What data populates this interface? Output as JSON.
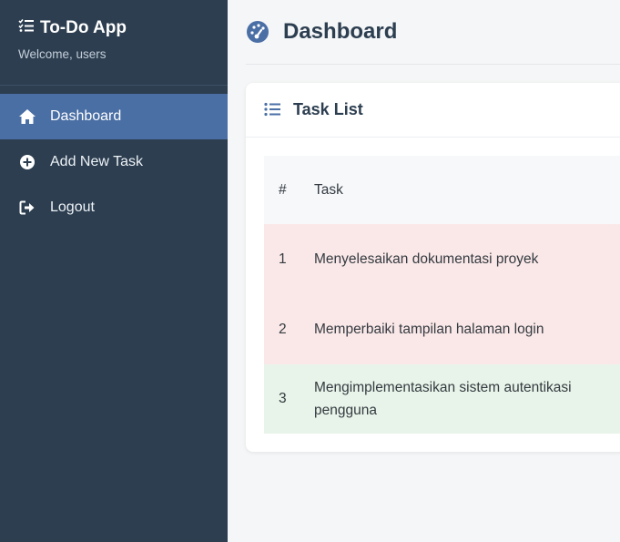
{
  "app": {
    "title": "To-Do App",
    "welcome": "Welcome, users"
  },
  "sidebar": {
    "items": [
      {
        "label": "Dashboard",
        "icon": "home-icon",
        "active": true
      },
      {
        "label": "Add New Task",
        "icon": "plus-circle-icon",
        "active": false
      },
      {
        "label": "Logout",
        "icon": "logout-icon",
        "active": false
      }
    ]
  },
  "page": {
    "title": "Dashboard",
    "icon": "dashboard-gauge-icon"
  },
  "task_card": {
    "title": "Task List",
    "icon": "list-icon",
    "columns": [
      "#",
      "Task"
    ],
    "rows": [
      {
        "num": "1",
        "task": "Menyelesaikan dokumentasi proyek",
        "status": "pending"
      },
      {
        "num": "2",
        "task": "Memperbaiki tampilan halaman login",
        "status": "pending"
      },
      {
        "num": "3",
        "task": "Mengimplementasikan sistem autentikasi pengguna",
        "status": "done"
      }
    ]
  },
  "colors": {
    "sidebar_bg": "#2c3e50",
    "active_bg": "#4a6fa5",
    "pending_row": "#fae8e8",
    "done_row": "#e8f4e9",
    "accent": "#4a6fa5"
  }
}
